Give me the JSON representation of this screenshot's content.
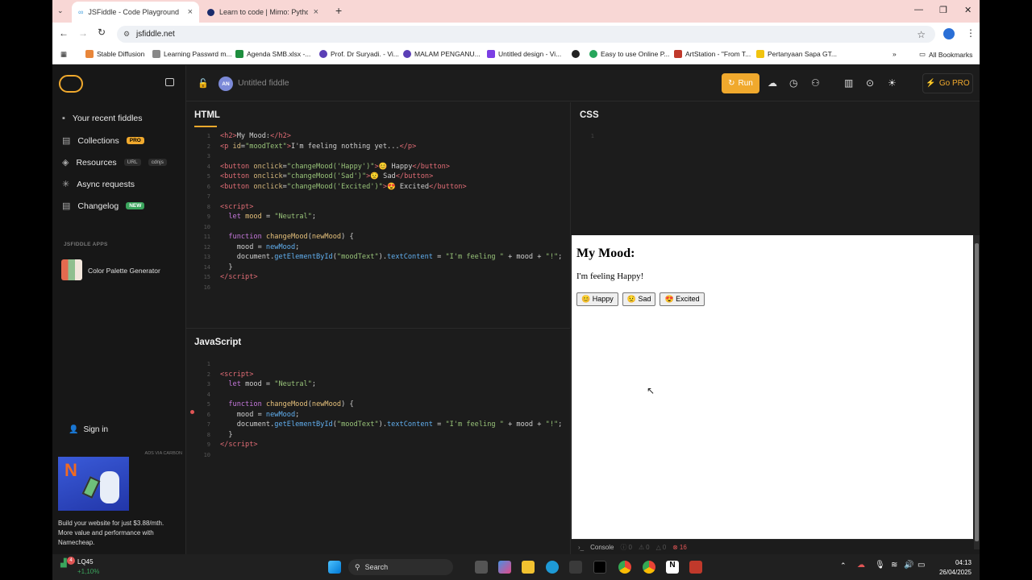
{
  "browser": {
    "tabs": [
      {
        "title": "JSFiddle - Code Playground"
      },
      {
        "title": "Learn to code | Mimo: Python, J"
      }
    ],
    "url": "jsfiddle.net",
    "bookmarks": [
      "Stable Diffusion",
      "Learning Passwrd m...",
      "Agenda SMB.xlsx -...",
      "Prof. Dr Suryadi. - Vi...",
      "MALAM PENGANU...",
      "Untitled design - Vi...",
      "Easy to use Online P...",
      "ArtStation - \"From T...",
      "Pertanyaan Sapa GT..."
    ],
    "all_bookmarks": "All Bookmarks"
  },
  "app": {
    "fiddle_name": "Untitled fiddle",
    "avatar": "AN",
    "run_label": "Run",
    "go_pro": "Go PRO"
  },
  "sidebar": {
    "items": [
      {
        "label": "Your recent fiddles"
      },
      {
        "label": "Collections",
        "badge": "PRO"
      },
      {
        "label": "Resources",
        "tags": [
          "URL",
          "cdnjs"
        ]
      },
      {
        "label": "Async requests"
      },
      {
        "label": "Changelog",
        "badge": "NEW"
      }
    ],
    "apps_heading": "JSFIDDLE APPS",
    "app_item": "Color Palette Generator",
    "sign_in": "Sign in",
    "ads_label": "ADS VIA CARBON",
    "ad_text": "Build your website for just $3.88/mth. More value and performance with Namecheap."
  },
  "panels": {
    "html": "HTML",
    "css": "CSS",
    "js": "JavaScript",
    "css_line": "1"
  },
  "output": {
    "heading": "My Mood:",
    "text": "I'm feeling Happy!",
    "buttons": [
      "😊 Happy",
      "😟 Sad",
      "😍 Excited"
    ]
  },
  "console": {
    "label": "Console",
    "counts": [
      "0",
      "0",
      "0",
      "16"
    ]
  },
  "taskbar": {
    "ticker": "LQ45",
    "ticker_change": "+1,10%",
    "ticker_badge": "4",
    "search": "Search",
    "time": "04:13",
    "date": "26/04/2025"
  }
}
